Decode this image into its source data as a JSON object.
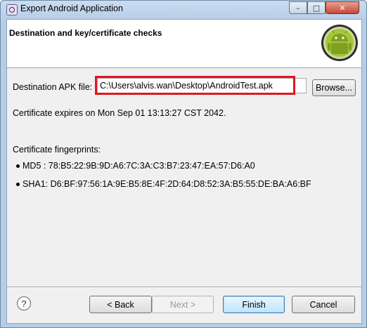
{
  "window": {
    "title": "Export Android Application",
    "min_glyph": "–",
    "max_glyph": "□",
    "close_glyph": "✕"
  },
  "banner": {
    "title": "Destination and key/certificate checks",
    "icon": "android-icon"
  },
  "destination": {
    "label": "Destination APK file:",
    "value": "C:\\Users\\alvis.wan\\Desktop\\AndroidTest.apk",
    "browse_label": "Browse..."
  },
  "certificate": {
    "expires_text": "Certificate expires on Mon Sep 01 13:13:27 CST 2042.",
    "fingerprints_heading": "Certificate fingerprints:",
    "md5": "MD5 : 78:B5:22:9B:9D:A6:7C:3A:C3:B7:23:47:EA:57:D6:A0",
    "sha1": "SHA1: D6:BF:97:56:1A:9E:B5:8E:4F:2D:64:D8:52:3A:B5:55:DE:BA:A6:BF"
  },
  "footer": {
    "help_glyph": "?",
    "back_label": "< Back",
    "next_label": "Next >",
    "finish_label": "Finish",
    "cancel_label": "Cancel"
  },
  "colors": {
    "highlight": "#e01722",
    "android_green": "#a4c639"
  }
}
